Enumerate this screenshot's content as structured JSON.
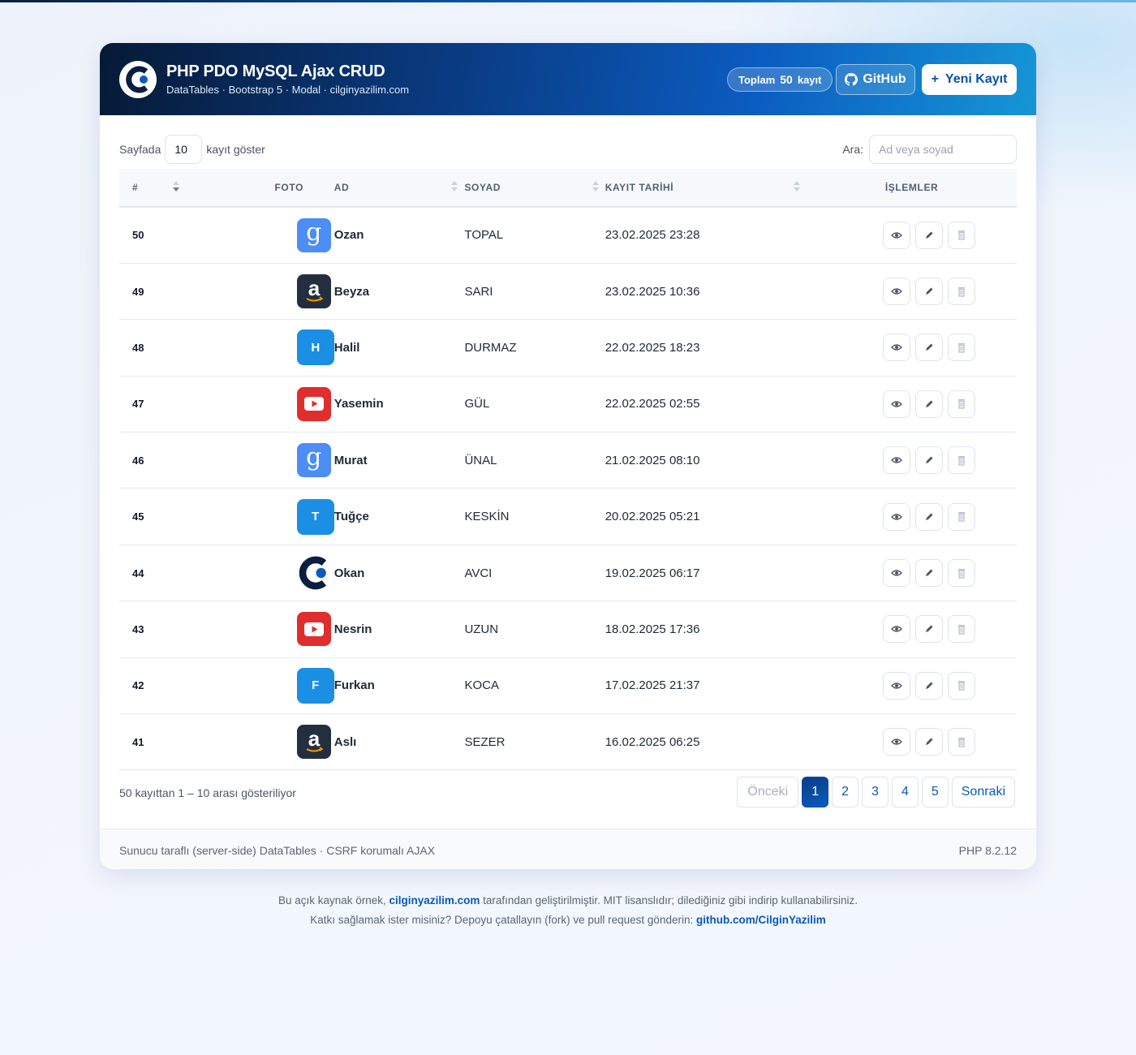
{
  "header": {
    "title": "PHP PDO MySQL Ajax CRUD",
    "subtitle": "DataTables · Bootstrap 5 · Modal · cilginyazilim.com",
    "total_prefix": "Toplam",
    "total_count": "50",
    "total_suffix": "kayıt",
    "github_label": "GitHub",
    "new_label": "Yeni Kayıt",
    "new_icon": "+"
  },
  "controls": {
    "length_prefix": "Sayfada",
    "length_value": "10",
    "length_suffix": "kayıt göster",
    "search_label": "Ara:",
    "search_placeholder": "Ad veya soyad"
  },
  "table": {
    "columns": [
      "#",
      "FOTO",
      "AD",
      "SOYAD",
      "KAYIT TARİHİ",
      "İŞLEMLER"
    ],
    "rows": [
      {
        "id": "50",
        "photo": "google",
        "photo_letter": "g",
        "ad": "Ozan",
        "soyad": "TOPAL",
        "tarih": "23.02.2025 23:28"
      },
      {
        "id": "49",
        "photo": "amazon",
        "photo_letter": "a",
        "ad": "Beyza",
        "soyad": "SARI",
        "tarih": "23.02.2025 10:36"
      },
      {
        "id": "48",
        "photo": "letter",
        "photo_letter": "H",
        "ad": "Halil",
        "soyad": "DURMAZ",
        "tarih": "22.02.2025 18:23"
      },
      {
        "id": "47",
        "photo": "youtube",
        "photo_letter": "",
        "ad": "Yasemin",
        "soyad": "GÜL",
        "tarih": "22.02.2025 02:55"
      },
      {
        "id": "46",
        "photo": "google",
        "photo_letter": "g",
        "ad": "Murat",
        "soyad": "ÜNAL",
        "tarih": "21.02.2025 08:10"
      },
      {
        "id": "45",
        "photo": "letter",
        "photo_letter": "T",
        "ad": "Tuğçe",
        "soyad": "KESKİN",
        "tarih": "20.02.2025 05:21"
      },
      {
        "id": "44",
        "photo": "cilgin",
        "photo_letter": "",
        "ad": "Okan",
        "soyad": "AVCI",
        "tarih": "19.02.2025 06:17"
      },
      {
        "id": "43",
        "photo": "youtube",
        "photo_letter": "",
        "ad": "Nesrin",
        "soyad": "UZUN",
        "tarih": "18.02.2025 17:36"
      },
      {
        "id": "42",
        "photo": "letter",
        "photo_letter": "F",
        "ad": "Furkan",
        "soyad": "KOCA",
        "tarih": "17.02.2025 21:37"
      },
      {
        "id": "41",
        "photo": "amazon",
        "photo_letter": "a",
        "ad": "Aslı",
        "soyad": "SEZER",
        "tarih": "16.02.2025 06:25"
      }
    ],
    "action_icons": [
      "eye-icon",
      "pencil-icon",
      "trash-icon"
    ]
  },
  "pagination": {
    "info": "50 kayıttan 1 – 10 arası gösteriliyor",
    "prev": "Önceki",
    "pages": [
      "1",
      "2",
      "3",
      "4",
      "5"
    ],
    "active_page": "1",
    "next": "Sonraki"
  },
  "card_footer": {
    "left": "Sunucu taraflı (server-side) DataTables · CSRF korumalı AJAX",
    "right": "PHP 8.2.12"
  },
  "page_footer": {
    "line1_pre": "Bu açık kaynak örnek, ",
    "line1_link": "cilginyazilim.com",
    "line1_post": " tarafından geliştirilmiştir. MIT lisanslıdır; dilediğiniz gibi indirip kullanabilirsiniz.",
    "line2_pre": "Katkı sağlamak ister misiniz? Depoyu çatallayın (fork) ve pull request gönderin: ",
    "line2_link": "github.com/CilginYazilim"
  },
  "colors": {
    "header_start": "#061a36",
    "header_end": "#1596d6",
    "accent": "#0a58b8",
    "google": "#4c8df6",
    "amazon": "#232f3e",
    "letter_avatar": "#1a8fe3",
    "youtube": "#e02d2d"
  }
}
